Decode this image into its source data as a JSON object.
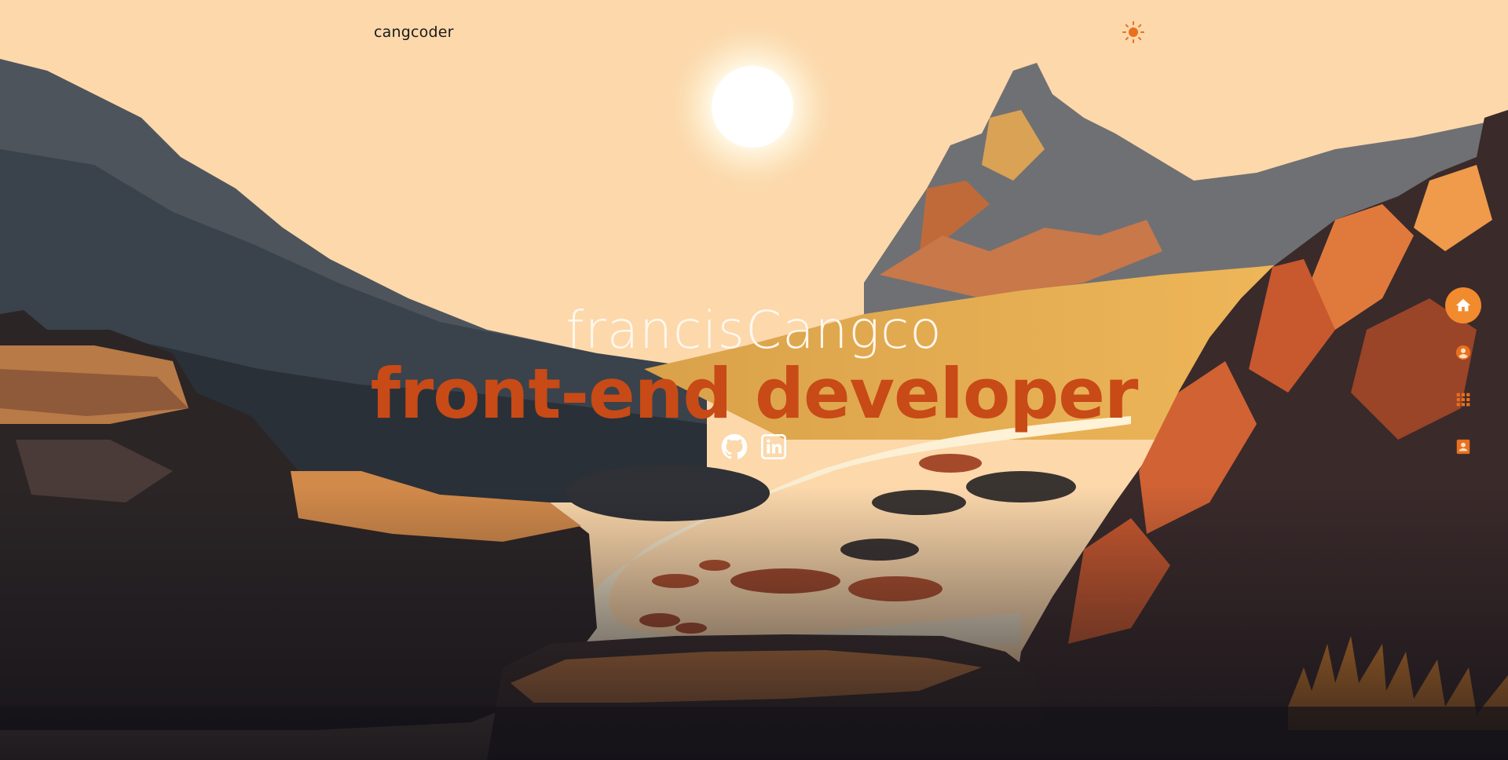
{
  "header": {
    "brand": "cangcoder",
    "theme_icon": "sun-icon"
  },
  "hero": {
    "name": "francisCangco",
    "role": "front-end developer"
  },
  "socials": [
    {
      "icon": "github-icon"
    },
    {
      "icon": "linkedin-icon"
    }
  ],
  "sidenav": [
    {
      "icon": "home-icon",
      "active": true
    },
    {
      "icon": "account-icon",
      "active": false
    },
    {
      "icon": "grid-icon",
      "active": false
    },
    {
      "icon": "contact-card-icon",
      "active": false
    }
  ],
  "colors": {
    "sky": "#fcd8ab",
    "accent": "#c84a17",
    "nav_active": "#f28a2e",
    "nav_icon": "#e8701e"
  }
}
